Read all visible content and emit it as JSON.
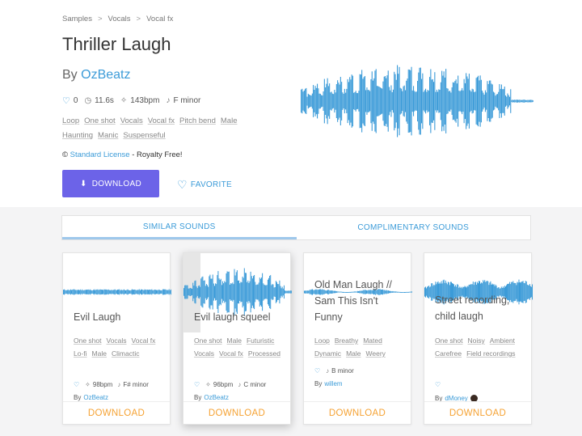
{
  "breadcrumb": [
    "Samples",
    "Vocals",
    "Vocal fx"
  ],
  "breadcrumb_sep": ">",
  "title": "Thriller Laugh",
  "by_prefix": "By",
  "author": "OzBeatz",
  "stats": {
    "likes": "0",
    "duration": "11.6s",
    "bpm": "143bpm",
    "key": "F minor"
  },
  "tags_row1": [
    "Loop",
    "One shot",
    "Vocals",
    "Vocal fx",
    "Pitch bend",
    "Male"
  ],
  "tags_row2": [
    "Haunting",
    "Manic",
    "Suspenseful"
  ],
  "license": {
    "symbol": "©",
    "link": "Standard License",
    "suffix": " - Royalty Free!"
  },
  "download_label": "DOWNLOAD",
  "favorite_label": "FAVORITE",
  "tabs": [
    "SIMILAR SOUNDS",
    "COMPLIMENTARY SOUNDS"
  ],
  "cards": [
    {
      "title": "Evil Laugh",
      "tags": [
        "One shot",
        "Vocals",
        "Vocal fx",
        "Lo-fi",
        "Male",
        "Climactic"
      ],
      "bpm": "98bpm",
      "key": "F# minor",
      "by": "By",
      "author": "OzBeatz",
      "download": "DOWNLOAD"
    },
    {
      "title": "Evil laugh squeel",
      "tags": [
        "One shot",
        "Male",
        "Futuristic",
        "Vocals",
        "Vocal fx",
        "Processed"
      ],
      "bpm": "96bpm",
      "key": "C minor",
      "by": "By",
      "author": "OzBeatz",
      "download": "DOWNLOAD"
    },
    {
      "title": "Old Man Laugh // Sam This Isn't Funny",
      "tags": [
        "Loop",
        "Breathy",
        "Mated",
        "Dynamic",
        "Male",
        "Weery"
      ],
      "key": "B minor",
      "by": "By",
      "author": "willem",
      "download": "DOWNLOAD"
    },
    {
      "title": "Street recording, child laugh",
      "tags": [
        "One shot",
        "Noisy",
        "Ambient",
        "Carefree",
        "Field recordings"
      ],
      "by": "By",
      "author": "dMoney",
      "download": "DOWNLOAD"
    }
  ],
  "colors": {
    "accent": "#3b9bd8",
    "download_btn": "#6c63e8",
    "card_download": "#f5a233"
  }
}
